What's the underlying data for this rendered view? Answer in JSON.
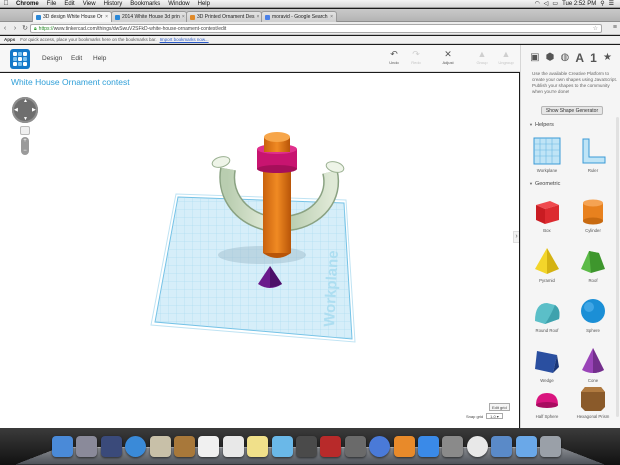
{
  "menubar": {
    "items": [
      "Chrome",
      "File",
      "Edit",
      "View",
      "History",
      "Bookmarks",
      "Window",
      "Help"
    ],
    "clock": "Tue 2:52 PM"
  },
  "tabs": [
    {
      "label": "3D design White House Or",
      "active": true,
      "favicon": "#2a88d8"
    },
    {
      "label": "2014 White House 3d prin",
      "active": false,
      "favicon": "#2a88d8"
    },
    {
      "label": "3D Printed Ornament Des",
      "active": false,
      "favicon": "#e08a2a"
    },
    {
      "label": "moravid - Google Search",
      "active": false,
      "favicon": "#4a80e8"
    }
  ],
  "address": {
    "protocol": "https://",
    "rest": "www.tinkercad.com/things/dwSwuV2SFkD-white-house-ornament-contest/edit"
  },
  "bookmarks": {
    "apps": "Apps",
    "hint": "For quick access, place your bookmarks here on the bookmarks bar.",
    "link": "Import bookmarks now..."
  },
  "header": {
    "menus": [
      "Design",
      "Edit",
      "Help"
    ],
    "tools": [
      {
        "label": "Undo",
        "glyph": "↶",
        "enabled": true
      },
      {
        "label": "Redo",
        "glyph": "↷",
        "enabled": false
      },
      {
        "label": "Adjust",
        "glyph": "✕",
        "enabled": true
      },
      {
        "label": "Group",
        "glyph": "▲",
        "enabled": false
      },
      {
        "label": "Ungroup",
        "glyph": "▲",
        "enabled": false
      }
    ]
  },
  "workspace": {
    "title": "White House Ornament contest",
    "workplane_label": "Workplane",
    "edit_grid": "Edit grid",
    "snap_label": "Snap grid",
    "snap_value": "1.0"
  },
  "panel": {
    "view_icons": [
      "cube-view-icon",
      "mesh-view-icon",
      "sphere-view-icon",
      "text-icon",
      "number-icon",
      "star-icon"
    ],
    "text_glyph": "A",
    "number_glyph": "1",
    "description": "Use the available Creative Platform to create your own shapes using JavaScript. Publish your shapes to the community when you're done!",
    "generator_button": "Show Shape Generator",
    "helpers_title": "Helpers",
    "helpers": [
      {
        "label": "Workplane"
      },
      {
        "label": "Ruler"
      }
    ],
    "geometric_title": "Geometric",
    "shapes": [
      {
        "label": "Box",
        "color": "#d8252b"
      },
      {
        "label": "Cylinder",
        "color": "#e8811e"
      },
      {
        "label": "Pyramid",
        "color": "#f0cf1f"
      },
      {
        "label": "Roof",
        "color": "#4caa3a"
      },
      {
        "label": "Round Roof",
        "color": "#5bbfc8"
      },
      {
        "label": "Sphere",
        "color": "#1b8fd6"
      },
      {
        "label": "Wedge",
        "color": "#1a3e8c"
      },
      {
        "label": "Cone",
        "color": "#8a3aa8"
      },
      {
        "label": "Half Sphere",
        "color": "#d9147e"
      },
      {
        "label": "Hexagonal Prism",
        "color": "#8a5a2a"
      }
    ]
  },
  "dock": {
    "icons": [
      {
        "name": "finder-icon",
        "color": "#4a8ad8"
      },
      {
        "name": "launchpad-icon",
        "color": "#8a8a9a"
      },
      {
        "name": "mission-control-icon",
        "color": "#3a4a7a"
      },
      {
        "name": "safari-icon",
        "color": "#3a8ad8"
      },
      {
        "name": "mail-icon",
        "color": "#c8c0a8"
      },
      {
        "name": "contacts-icon",
        "color": "#a8783a"
      },
      {
        "name": "calendar-icon",
        "color": "#f0f0f0"
      },
      {
        "name": "reminders-icon",
        "color": "#e8e8e8"
      },
      {
        "name": "notes-icon",
        "color": "#f0e08a"
      },
      {
        "name": "messages-icon",
        "color": "#6ab8e8"
      },
      {
        "name": "facetime-icon",
        "color": "#4a4a4a"
      },
      {
        "name": "photo-booth-icon",
        "color": "#b82a2a"
      },
      {
        "name": "iphoto-icon",
        "color": "#6a6a6a"
      },
      {
        "name": "itunes-icon",
        "color": "#4a7ad8"
      },
      {
        "name": "ibooks-icon",
        "color": "#e88a2a"
      },
      {
        "name": "app-store-icon",
        "color": "#3a8ae8"
      },
      {
        "name": "system-preferences-icon",
        "color": "#8a8a8a"
      },
      {
        "name": "chrome-icon",
        "color": "#e8e8e8"
      },
      {
        "name": "preview-icon",
        "color": "#5a8ac8"
      },
      {
        "name": "downloads-folder-icon",
        "color": "#6aa8e8"
      },
      {
        "name": "trash-icon",
        "color": "#9aa0a8"
      }
    ]
  }
}
